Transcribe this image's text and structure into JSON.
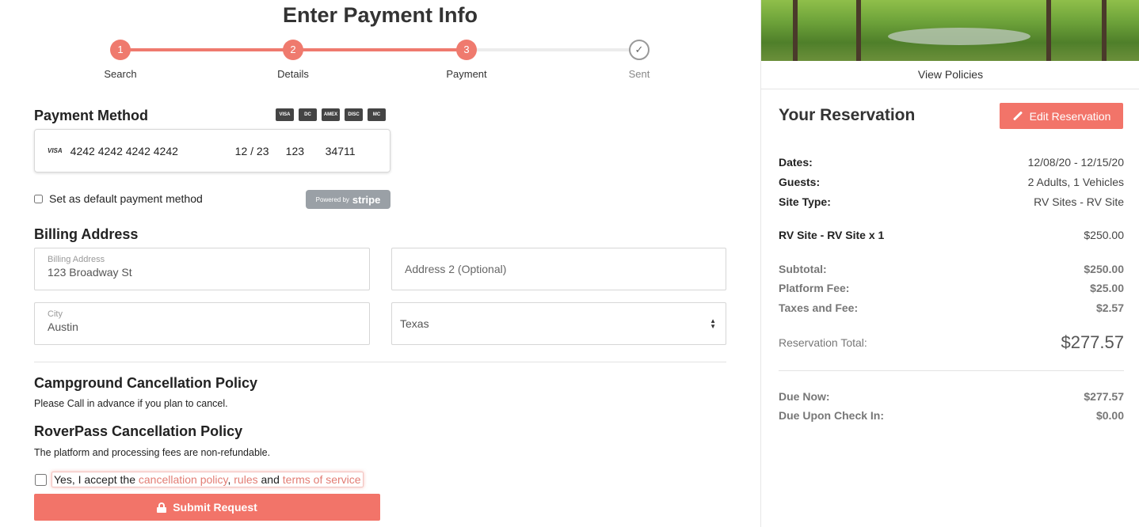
{
  "page": {
    "title": "Enter Payment Info"
  },
  "stepper": {
    "steps": [
      {
        "number": "1",
        "label": "Search"
      },
      {
        "number": "2",
        "label": "Details"
      },
      {
        "number": "3",
        "label": "Payment"
      },
      {
        "number": "✓",
        "label": "Sent"
      }
    ]
  },
  "payment": {
    "heading": "Payment Method",
    "card_icons": [
      "VISA",
      "DC",
      "AMEX",
      "DISC",
      "MC"
    ],
    "card_brand": "VISA",
    "card_number": "4242 4242 4242 4242",
    "expiry": "12 / 23",
    "cvc": "123",
    "zip": "34711",
    "default_label": "Set as default payment method",
    "stripe_prefix": "Powered by",
    "stripe_brand": "stripe"
  },
  "billing": {
    "heading": "Billing Address",
    "address_label": "Billing Address",
    "address_value": "123 Broadway St",
    "address2_placeholder": "Address 2 (Optional)",
    "city_label": "City",
    "city_value": "Austin",
    "state_value": "Texas"
  },
  "policies": {
    "campground_heading": "Campground Cancellation Policy",
    "campground_text": "Please Call in advance if you plan to cancel.",
    "roverpass_heading": "RoverPass Cancellation Policy",
    "roverpass_text": "The platform and processing fees are non-refundable.",
    "accept_prefix": "Yes, I accept the ",
    "link_cancellation": "cancellation policy",
    "comma": ", ",
    "link_rules": "rules",
    "and_text": " and ",
    "link_terms": "terms of service"
  },
  "submit_label": "Submit Request",
  "sidebar": {
    "view_policies": "View Policies",
    "title": "Your Reservation",
    "edit_label": "Edit Reservation",
    "dates_key": "Dates:",
    "dates_val": "12/08/20 - 12/15/20",
    "guests_key": "Guests:",
    "guests_val": "2 Adults, 1 Vehicles",
    "site_type_key": "Site Type:",
    "site_type_val": "RV Sites - RV Site",
    "item_key": "RV Site - RV Site x 1",
    "item_val": "$250.00",
    "subtotal_key": "Subtotal:",
    "subtotal_val": "$250.00",
    "platform_key": "Platform Fee:",
    "platform_val": "$25.00",
    "taxes_key": "Taxes and Fee:",
    "taxes_val": "$2.57",
    "total_key": "Reservation Total:",
    "total_val": "$277.57",
    "due_now_key": "Due Now:",
    "due_now_val": "$277.57",
    "due_checkin_key": "Due Upon Check In:",
    "due_checkin_val": "$0.00"
  },
  "colors": {
    "accent": "#f27469",
    "link": "#e27d74"
  }
}
